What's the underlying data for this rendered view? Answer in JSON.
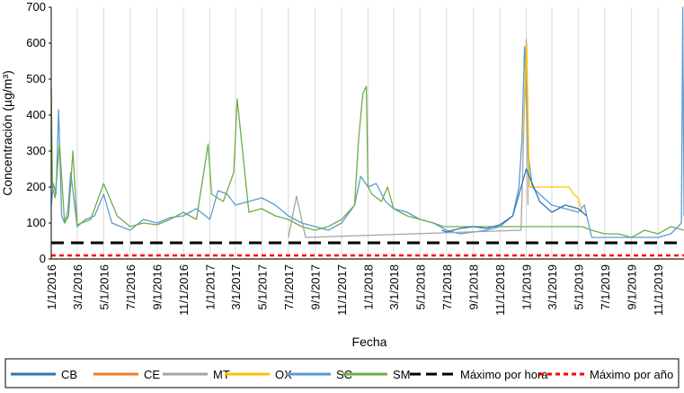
{
  "chart_data": {
    "type": "line",
    "xlabel": "Fecha",
    "ylabel": "Concentración (µg/m³)",
    "ylim": [
      0,
      700
    ],
    "yticks": [
      0,
      100,
      200,
      300,
      400,
      500,
      600,
      700
    ],
    "xlim": [
      "2016-01-01",
      "2019-12-31"
    ],
    "x_tick_labels": [
      "1/1/2016",
      "3/1/2016",
      "5/1/2016",
      "7/1/2016",
      "9/1/2016",
      "11/1/2016",
      "1/1/2017",
      "3/1/2017",
      "5/1/2017",
      "7/1/2017",
      "9/1/2017",
      "11/1/2017",
      "1/1/2018",
      "3/1/2018",
      "5/1/2018",
      "7/1/2018",
      "9/1/2018",
      "11/1/2018",
      "1/1/2019",
      "3/1/2019",
      "5/1/2019",
      "7/1/2019",
      "9/1/2019",
      "11/1/2019"
    ],
    "grid": "vertical",
    "legend_position": "bottom",
    "series": [
      {
        "name": "SC",
        "color": "#5B9BD5",
        "x": [
          "2016-01-01",
          "2016-01-06",
          "2016-01-12",
          "2016-01-18",
          "2016-01-25",
          "2016-02-01",
          "2016-02-08",
          "2016-02-15",
          "2016-03-01",
          "2016-03-20",
          "2016-04-10",
          "2016-05-01",
          "2016-05-20",
          "2016-06-10",
          "2016-07-01",
          "2016-08-01",
          "2016-09-01",
          "2016-10-01",
          "2016-11-01",
          "2016-12-01",
          "2017-01-01",
          "2017-01-20",
          "2017-02-10",
          "2017-03-01",
          "2017-04-01",
          "2017-05-01",
          "2017-06-01",
          "2017-07-01",
          "2017-08-01",
          "2017-09-01",
          "2017-10-01",
          "2017-11-01",
          "2017-12-01",
          "2017-12-15",
          "2018-01-01",
          "2018-01-20",
          "2018-02-10",
          "2018-03-01",
          "2018-04-01",
          "2018-05-01",
          "2018-06-01",
          "2018-07-01",
          "2018-08-01",
          "2018-09-01",
          "2018-10-01",
          "2018-11-01",
          "2018-12-01",
          "2018-12-15",
          "2018-12-22",
          "2018-12-28",
          "2019-01-05",
          "2019-01-15",
          "2019-02-01",
          "2019-03-01",
          "2019-04-01",
          "2019-05-01",
          "2019-05-15",
          "2019-06-01",
          "2019-07-01",
          "2019-08-01",
          "2019-09-01",
          "2019-10-01",
          "2019-11-01",
          "2019-12-01",
          "2019-12-25",
          "2019-12-28",
          "2019-12-31"
        ],
        "y": [
          150,
          210,
          180,
          415,
          120,
          100,
          130,
          240,
          90,
          110,
          120,
          180,
          100,
          90,
          80,
          110,
          100,
          115,
          120,
          140,
          110,
          190,
          180,
          150,
          160,
          170,
          150,
          120,
          100,
          90,
          80,
          100,
          150,
          230,
          200,
          210,
          160,
          140,
          130,
          110,
          100,
          80,
          70,
          75,
          80,
          90,
          120,
          200,
          330,
          590,
          300,
          200,
          180,
          150,
          140,
          130,
          150,
          60,
          60,
          60,
          60,
          60,
          60,
          70,
          100,
          700,
          120
        ]
      },
      {
        "name": "SM",
        "color": "#70AD47",
        "x": [
          "2016-01-01",
          "2016-01-04",
          "2016-01-10",
          "2016-01-20",
          "2016-02-01",
          "2016-02-10",
          "2016-02-20",
          "2016-03-01",
          "2016-04-01",
          "2016-05-01",
          "2016-06-01",
          "2016-07-01",
          "2016-08-01",
          "2016-09-01",
          "2016-10-01",
          "2016-11-01",
          "2016-12-01",
          "2016-12-28",
          "2017-01-05",
          "2017-02-01",
          "2017-02-25",
          "2017-03-05",
          "2017-04-01",
          "2017-05-01",
          "2017-06-01",
          "2017-07-01",
          "2017-08-01",
          "2017-09-01",
          "2017-10-01",
          "2017-11-01",
          "2017-12-01",
          "2017-12-10",
          "2017-12-20",
          "2017-12-28",
          "2018-01-01",
          "2018-01-10",
          "2018-02-01",
          "2018-02-15",
          "2018-03-01",
          "2018-04-01",
          "2018-05-01",
          "2018-06-01",
          "2018-06-25",
          "2019-05-10",
          "2019-06-01",
          "2019-07-01",
          "2019-08-01",
          "2019-09-01",
          "2019-10-01",
          "2019-11-01",
          "2019-12-01",
          "2019-12-31"
        ],
        "y": [
          475,
          200,
          170,
          320,
          100,
          120,
          300,
          95,
          110,
          210,
          120,
          90,
          100,
          95,
          110,
          130,
          110,
          320,
          180,
          160,
          240,
          445,
          130,
          140,
          120,
          110,
          90,
          80,
          90,
          110,
          150,
          330,
          460,
          480,
          200,
          180,
          160,
          200,
          140,
          120,
          110,
          100,
          90,
          90,
          80,
          70,
          70,
          60,
          80,
          70,
          90,
          80
        ]
      },
      {
        "name": "MT",
        "color": "#A5A5A5",
        "x": [
          "2017-07-01",
          "2017-07-20",
          "2017-08-10",
          "2018-12-20",
          "2019-01-01",
          "2019-01-05"
        ],
        "y": [
          60,
          175,
          60,
          80,
          610,
          150
        ]
      },
      {
        "name": "OX",
        "color": "#FFC000",
        "x": [
          "2018-12-25",
          "2019-01-02",
          "2019-01-08",
          "2019-04-10",
          "2019-04-20",
          "2019-05-01",
          "2019-05-10"
        ],
        "y": [
          340,
          600,
          200,
          200,
          180,
          170,
          130
        ]
      },
      {
        "name": "CB",
        "color": "#2E75B6",
        "x": [
          "2018-06-20",
          "2018-07-01",
          "2018-08-01",
          "2018-09-01",
          "2018-10-01",
          "2018-11-01",
          "2018-12-01",
          "2019-01-01",
          "2019-02-01",
          "2019-03-01",
          "2019-04-01",
          "2019-05-01",
          "2019-05-20"
        ],
        "y": [
          80,
          75,
          85,
          90,
          85,
          95,
          120,
          250,
          160,
          130,
          150,
          140,
          120
        ]
      },
      {
        "name": "CE",
        "color": "#ED7D31",
        "x": [
          "2016-01-01",
          "2019-12-31"
        ],
        "y": [
          0,
          0
        ]
      }
    ],
    "reference_lines": [
      {
        "name": "Máximo por hora",
        "value": 45,
        "color": "#000000",
        "style": "dashed"
      },
      {
        "name": "Máximo por año",
        "value": 10,
        "color": "#FF0000",
        "style": "dotted"
      }
    ],
    "legend": [
      {
        "name": "CB",
        "color": "#2E75B6",
        "style": "solid"
      },
      {
        "name": "CE",
        "color": "#ED7D31",
        "style": "solid"
      },
      {
        "name": "MT",
        "color": "#A5A5A5",
        "style": "solid"
      },
      {
        "name": "OX",
        "color": "#FFC000",
        "style": "solid"
      },
      {
        "name": "SC",
        "color": "#5B9BD5",
        "style": "solid"
      },
      {
        "name": "SM",
        "color": "#70AD47",
        "style": "solid"
      },
      {
        "name": "Máximo por hora",
        "color": "#000000",
        "style": "dashed"
      },
      {
        "name": "Máximo por año",
        "color": "#FF0000",
        "style": "dotted"
      }
    ]
  }
}
